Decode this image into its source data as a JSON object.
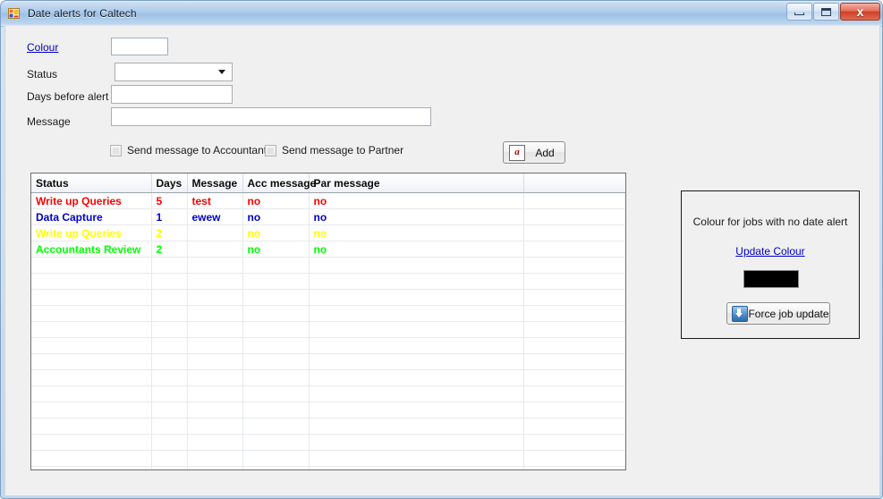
{
  "window": {
    "title": "Date alerts for Caltech",
    "icon": "form-icon",
    "buttons": {
      "minimize": "minimize-icon",
      "maximize": "maximize-icon",
      "close": "x"
    }
  },
  "form": {
    "colour_link": "Colour",
    "colour_value": "",
    "status_label": "Status",
    "status_value": "",
    "days_label": "Days before alert",
    "days_value": "",
    "message_label": "Message",
    "message_value": "",
    "checkbox_accountant": "Send message to Accountant",
    "checkbox_partner": "Send message to Partner",
    "add_button": "Add",
    "add_button_icon": "document-a-icon"
  },
  "grid": {
    "columns": [
      "Status",
      "Days",
      "Message",
      "Acc message",
      "Par message",
      ""
    ],
    "rows": [
      {
        "status": "Write up Queries",
        "days": "5",
        "message": "test",
        "acc_message": "no",
        "par_message": "no",
        "extra": "",
        "colour": "#FF0000"
      },
      {
        "status": "Data Capture",
        "days": "1",
        "message": "ewew",
        "acc_message": "no",
        "par_message": "no",
        "extra": "",
        "colour": "#0000CC"
      },
      {
        "status": "Write up Queries",
        "days": "2",
        "message": "",
        "acc_message": "no",
        "par_message": "no",
        "extra": "",
        "colour": "#FFFF00"
      },
      {
        "status": "Accountants Review",
        "days": "2",
        "message": "",
        "acc_message": "no",
        "par_message": "no",
        "extra": "",
        "colour": "#00FF00"
      }
    ],
    "empty_row_count": 14
  },
  "panel": {
    "title": "Colour for jobs with no date alert",
    "update_link": "Update Colour",
    "swatch_colour": "#000000",
    "force_button": "Force job update",
    "force_button_icon": "job-update-icon"
  }
}
